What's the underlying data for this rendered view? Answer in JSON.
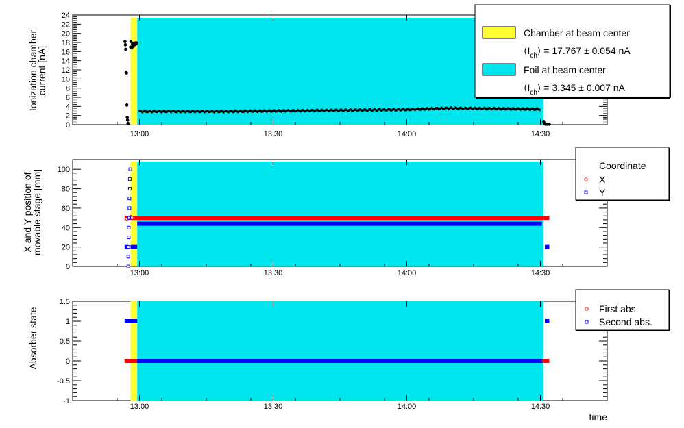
{
  "chart_data": [
    {
      "type": "scatter",
      "panel": "current",
      "ylabel_lines": [
        "Ionization chamber",
        "current  [nA]"
      ],
      "xlim_hours": [
        12.75,
        14.75
      ],
      "x_ticks": [
        "13:00",
        "13:30",
        "14:00",
        "14:30"
      ],
      "ylim": [
        0,
        24
      ],
      "y_ticks": [
        0,
        2,
        4,
        6,
        8,
        10,
        12,
        14,
        16,
        18,
        20,
        22,
        24
      ],
      "bands": [
        {
          "name": "Chamber at beam center",
          "from": "12:58",
          "to": "12:59:30",
          "color": "#ffff33"
        },
        {
          "name": "Foil at beam center",
          "from": "12:59:30",
          "to": "14:30:40",
          "color": "#00e5ee"
        }
      ],
      "series": [
        {
          "color": "#000000",
          "points": [
            [
              "12:56:45",
              18.2
            ],
            [
              "12:56:50",
              17.5
            ],
            [
              "12:56:55",
              16.5
            ],
            [
              "12:57:00",
              11.5
            ],
            [
              "12:57:05",
              11.3
            ],
            [
              "12:57:10",
              4.3
            ],
            [
              "12:57:15",
              1.6
            ],
            [
              "12:57:20",
              1.0
            ],
            [
              "12:57:25",
              0.3
            ],
            [
              "12:58:00",
              17.0
            ],
            [
              "12:58:05",
              18.2
            ],
            [
              "12:58:15",
              16.8
            ],
            [
              "12:58:25",
              17.6
            ],
            [
              "12:58:35",
              17.1
            ],
            [
              "12:58:45",
              17.8
            ],
            [
              "12:58:55",
              17.5
            ],
            [
              "12:59:05",
              17.9
            ],
            [
              "12:59:15",
              17.7
            ],
            [
              "12:59:25",
              17.9
            ],
            [
              "14:30:45",
              0.7
            ],
            [
              "14:30:55",
              0.3
            ],
            [
              "14:31:10",
              0.1
            ],
            [
              "14:31:30",
              0.1
            ],
            [
              "14:32:00",
              0.1
            ]
          ],
          "trend": [
            [
              "13:00",
              2.9
            ],
            [
              "13:10",
              2.9
            ],
            [
              "13:20",
              2.9
            ],
            [
              "13:30",
              3.0
            ],
            [
              "13:40",
              3.1
            ],
            [
              "13:50",
              3.2
            ],
            [
              "14:00",
              3.3
            ],
            [
              "14:05",
              3.5
            ],
            [
              "14:10",
              3.6
            ],
            [
              "14:20",
              3.5
            ],
            [
              "14:30",
              3.4
            ]
          ]
        }
      ],
      "legend": {
        "entries": [
          {
            "label": "Chamber at beam center",
            "detail": "⟨I",
            "detail_sub": "ch",
            "detail_value": "⟩ = 17.767 ± 0.054 nA",
            "color": "#ffff33"
          },
          {
            "label": "Foil at beam center",
            "detail": "⟨I",
            "detail_sub": "ch",
            "detail_value": "⟩ = 3.345 ± 0.007 nA",
            "color": "#00e5ee"
          }
        ]
      }
    },
    {
      "type": "scatter",
      "panel": "position",
      "ylabel_lines": [
        "X and Y position of",
        "movable stage [mm]"
      ],
      "xlim_hours": [
        12.75,
        14.75
      ],
      "x_ticks": [
        "13:00",
        "13:30",
        "14:00",
        "14:30"
      ],
      "ylim": [
        0,
        110
      ],
      "y_ticks": [
        0,
        20,
        40,
        60,
        80,
        100
      ],
      "legend": {
        "title": "Coordinate"
      },
      "series": [
        {
          "name": "X",
          "marker": "circle",
          "color": "#ff0000",
          "segments": [
            [
              "12:56:40",
              "14:32:00",
              50
            ]
          ],
          "points": [
            [
              "12:57:10",
              49
            ],
            [
              "12:57:30",
              50
            ],
            [
              "12:58:00",
              51
            ],
            [
              "12:58:20",
              50
            ]
          ]
        },
        {
          "name": "Y",
          "marker": "square",
          "color": "#0000ff",
          "segments": [
            [
              "12:56:40",
              "12:57:30",
              20
            ],
            [
              "12:58:00",
              "12:59:30",
              20
            ],
            [
              "12:59:30",
              "14:30:20",
              44
            ],
            [
              "14:31:00",
              "14:32:00",
              20
            ]
          ],
          "points": [
            [
              "12:57:30",
              0
            ],
            [
              "12:57:30",
              10
            ],
            [
              "12:57:30",
              20
            ],
            [
              "12:57:35",
              30
            ],
            [
              "12:57:35",
              40
            ],
            [
              "12:57:40",
              50
            ],
            [
              "12:57:45",
              60
            ],
            [
              "12:57:45",
              70
            ],
            [
              "12:57:50",
              80
            ],
            [
              "12:57:50",
              90
            ],
            [
              "12:57:55",
              100
            ]
          ]
        }
      ]
    },
    {
      "type": "scatter",
      "panel": "absorber",
      "ylabel_lines": [
        "Absorber state"
      ],
      "xlabel": "time",
      "xlim_hours": [
        12.75,
        14.75
      ],
      "x_ticks": [
        "13:00",
        "13:30",
        "14:00",
        "14:30"
      ],
      "ylim": [
        -1,
        1.5
      ],
      "y_ticks": [
        -1,
        -0.5,
        0,
        0.5,
        1,
        1.5
      ],
      "series": [
        {
          "name": "First abs.",
          "marker": "circle",
          "color": "#ff0000",
          "segments": [
            [
              "12:56:40",
              "14:32:00",
              0
            ]
          ]
        },
        {
          "name": "Second abs.",
          "marker": "square",
          "color": "#0000ff",
          "segments": [
            [
              "12:56:40",
              "12:59:30",
              1
            ],
            [
              "12:59:30",
              "14:30:20",
              0
            ],
            [
              "14:31:00",
              "14:32:00",
              1
            ]
          ]
        }
      ]
    }
  ]
}
